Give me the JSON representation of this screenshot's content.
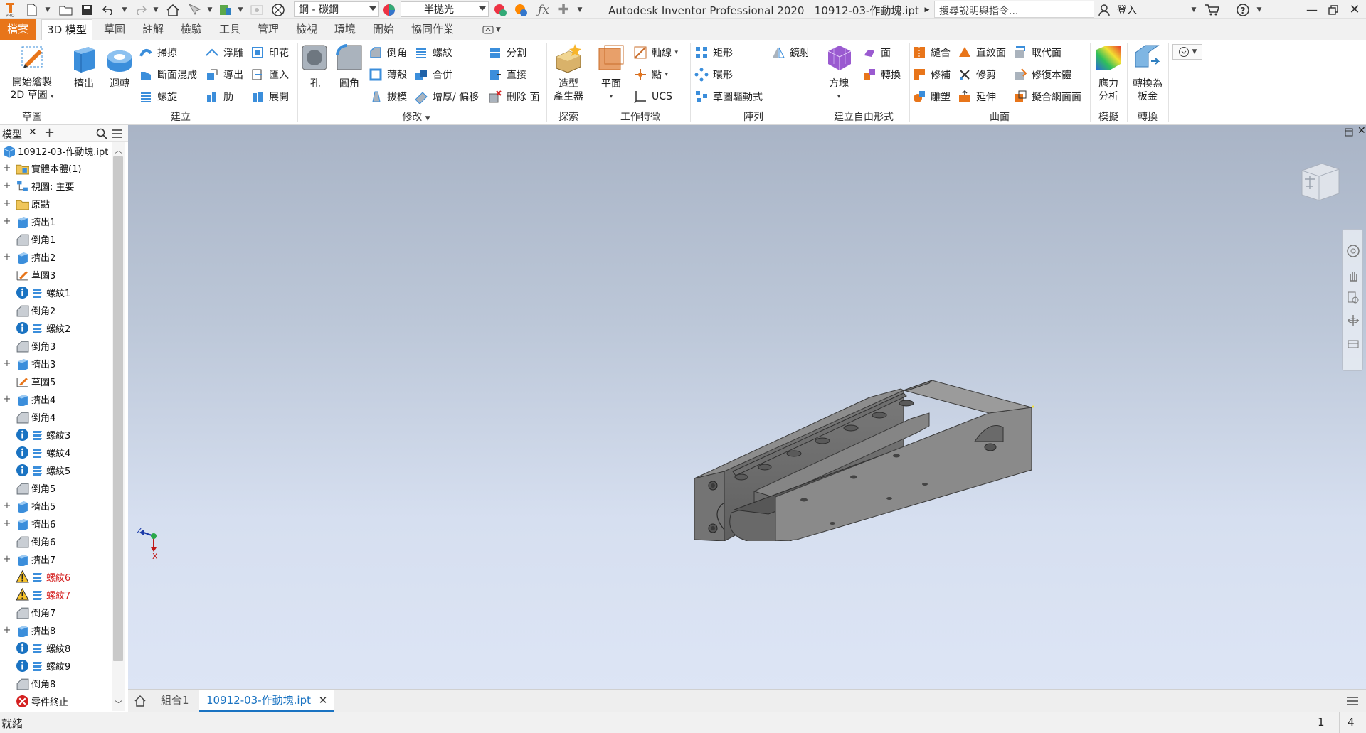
{
  "titlebar": {
    "app_title": "Autodesk Inventor Professional 2020",
    "file_name": "10912-03-作動塊.ipt",
    "search_placeholder": "搜尋說明與指令...",
    "login_label": "登入",
    "material_value": "鋼 - 碳鋼",
    "appearance_value": "半拋光"
  },
  "tabs": [
    "檔案",
    "3D 模型",
    "草圖",
    "註解",
    "檢驗",
    "工具",
    "管理",
    "檢視",
    "環境",
    "開始",
    "協同作業"
  ],
  "ribbon": {
    "sketch": {
      "start_sketch": "開始繪製",
      "sketch_2d": "2D 草圖",
      "group": "草圖"
    },
    "create": {
      "extrude": "擠出",
      "revolve": "迴轉",
      "sweep": "掃掠",
      "loft": "斷面混成",
      "coil": "螺旋",
      "emboss": "浮雕",
      "derive": "導出",
      "rib": "肋",
      "decal": "印花",
      "import": "匯入",
      "unwrap": "展開",
      "group": "建立"
    },
    "modify": {
      "hole": "孔",
      "fillet": "圓角",
      "chamfer": "倒角",
      "shell": "薄殼",
      "draft": "拔模",
      "thread": "螺紋",
      "combine": "合併",
      "thicken": "增厚/ 偏移",
      "split": "分割",
      "direct": "直接",
      "delete_face": "刪除 面",
      "group": "修改"
    },
    "explore": {
      "shape_generator_1": "造型",
      "shape_generator_2": "產生器",
      "group": "探索"
    },
    "work": {
      "plane": "平面",
      "axis": "軸線",
      "point": "點",
      "ucs": "UCS",
      "group": "工作特徵"
    },
    "pattern": {
      "rect": "矩形",
      "circ": "環形",
      "sketch_driven": "草圖驅動式",
      "mirror": "鏡射",
      "group": "陣列"
    },
    "freeform": {
      "box": "方塊",
      "face": "面",
      "convert": "轉換",
      "group": "建立自由形式"
    },
    "surface": {
      "stitch": "縫合",
      "ruled": "直紋面",
      "replace": "取代面",
      "patch": "修補",
      "trim": "修剪",
      "repair": "修復本體",
      "sculpt": "雕塑",
      "extend": "延伸",
      "fit_mesh": "擬合網面面",
      "group": "曲面"
    },
    "simulation": {
      "stress_1": "應力",
      "stress_2": "分析",
      "group": "模擬"
    },
    "convert": {
      "sheet_1": "轉換為",
      "sheet_2": "板金",
      "group": "轉換"
    }
  },
  "browser": {
    "tab_label": "模型",
    "root": "10912-03-作動塊.ipt",
    "nodes": [
      {
        "label": "實體本體(1)",
        "icon": "solid-bodies-folder-icon",
        "expand": true
      },
      {
        "label": "視圖: 主要",
        "icon": "view-rep-icon",
        "expand": true
      },
      {
        "label": "原點",
        "icon": "origin-folder-icon",
        "expand": true
      },
      {
        "label": "擠出1",
        "icon": "extrude-icon",
        "expand": true
      },
      {
        "label": "倒角1",
        "icon": "chamfer-icon",
        "expand": false
      },
      {
        "label": "擠出2",
        "icon": "extrude-icon",
        "expand": true
      },
      {
        "label": "草圖3",
        "icon": "sketch-icon",
        "expand": false
      },
      {
        "label": "螺紋1",
        "icon": "thread-icon",
        "expand": false,
        "info": true
      },
      {
        "label": "倒角2",
        "icon": "chamfer-icon",
        "expand": false
      },
      {
        "label": "螺紋2",
        "icon": "thread-icon",
        "expand": false,
        "info": true
      },
      {
        "label": "倒角3",
        "icon": "chamfer-icon",
        "expand": false
      },
      {
        "label": "擠出3",
        "icon": "extrude-icon",
        "expand": true
      },
      {
        "label": "草圖5",
        "icon": "sketch-icon",
        "expand": false
      },
      {
        "label": "擠出4",
        "icon": "extrude-icon",
        "expand": true
      },
      {
        "label": "倒角4",
        "icon": "chamfer-icon",
        "expand": false
      },
      {
        "label": "螺紋3",
        "icon": "thread-icon",
        "expand": false,
        "info": true
      },
      {
        "label": "螺紋4",
        "icon": "thread-icon",
        "expand": false,
        "info": true
      },
      {
        "label": "螺紋5",
        "icon": "thread-icon",
        "expand": false,
        "info": true
      },
      {
        "label": "倒角5",
        "icon": "chamfer-icon",
        "expand": false
      },
      {
        "label": "擠出5",
        "icon": "extrude-icon",
        "expand": true
      },
      {
        "label": "擠出6",
        "icon": "extrude-icon",
        "expand": true
      },
      {
        "label": "倒角6",
        "icon": "chamfer-icon",
        "expand": false
      },
      {
        "label": "擠出7",
        "icon": "extrude-icon",
        "expand": true
      },
      {
        "label": "螺紋6",
        "icon": "thread-icon",
        "expand": false,
        "warn": true
      },
      {
        "label": "螺紋7",
        "icon": "thread-icon",
        "expand": false,
        "warn": true
      },
      {
        "label": "倒角7",
        "icon": "chamfer-icon",
        "expand": false
      },
      {
        "label": "擠出8",
        "icon": "extrude-icon",
        "expand": true
      },
      {
        "label": "螺紋8",
        "icon": "thread-icon",
        "expand": false,
        "info": true
      },
      {
        "label": "螺紋9",
        "icon": "thread-icon",
        "expand": false,
        "info": true
      },
      {
        "label": "倒角8",
        "icon": "chamfer-icon",
        "expand": false
      },
      {
        "label": "零件終止",
        "icon": "end-of-part-icon",
        "expand": false
      }
    ]
  },
  "doc_tabs": {
    "assembly": "組合1",
    "active": "10912-03-作動塊.ipt"
  },
  "triad": {
    "z": "Z",
    "x": "X"
  },
  "status": {
    "text": "就緒",
    "count1": "1",
    "count2": "4"
  },
  "colors": {
    "file_tab": "#e8751a",
    "accent": "#1a73c2",
    "viewport_top": "#a9b4c6",
    "viewport_bottom": "#dde5f5"
  }
}
